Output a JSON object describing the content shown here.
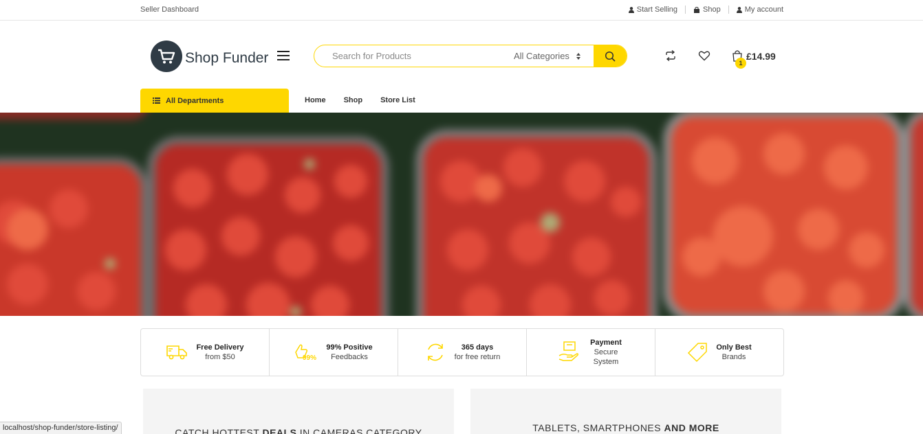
{
  "topbar": {
    "seller_dashboard": "Seller Dashboard",
    "links": [
      {
        "label": "Start Selling",
        "icon": "user-icon"
      },
      {
        "label": "Shop",
        "icon": "shop-icon"
      },
      {
        "label": "My account",
        "icon": "user-icon"
      }
    ]
  },
  "header": {
    "logo_text": "Shop Funder",
    "search_placeholder": "Search for Products",
    "category_selected": "All Categories",
    "cart_count": "1",
    "cart_total": "£14.99"
  },
  "nav": {
    "departments_label": "All Departments",
    "links": [
      "Home",
      "Shop",
      "Store List"
    ]
  },
  "features": [
    {
      "title": "Free Delivery",
      "sub": "from $50",
      "icon": "truck-icon"
    },
    {
      "title": "99% Positive",
      "sub": "Feedbacks",
      "icon": "thumbs-up-99-icon"
    },
    {
      "title": "365 days",
      "sub": "for free return",
      "icon": "refresh-icon"
    },
    {
      "title": "Payment",
      "sub": "Secure System",
      "icon": "payment-hand-icon"
    },
    {
      "title": "Only Best",
      "sub": "Brands",
      "icon": "tag-icon"
    }
  ],
  "promos": [
    {
      "pre": "CATCH HOTTEST ",
      "bold": "DEALS",
      "post": " IN CAMERAS CATEGORY"
    },
    {
      "pre": "TABLETS, SMARTPHONES ",
      "bold": "AND MORE",
      "post": ""
    }
  ],
  "status_url": "localhost/shop-funder/store-listing/",
  "colors": {
    "accent": "#fed700",
    "logo": "#2f3b45"
  }
}
